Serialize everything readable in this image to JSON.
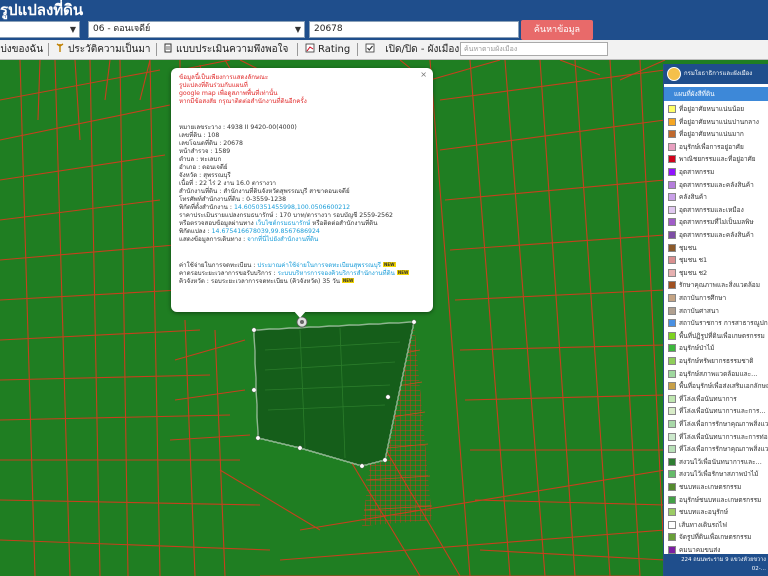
{
  "header": {
    "title": "รูปแปลงที่ดิน",
    "district_select": "06 - ดอนเจดีย์",
    "parcel_input": "20678",
    "search_button": "ค้นหาข้อมูล"
  },
  "toolbar": {
    "items": [
      {
        "label": "แบ่งของฉัน",
        "icon": "location-icon"
      },
      {
        "label": "ประวัติความเป็นมา",
        "icon": "history-icon"
      },
      {
        "label": "แบบประเมินความพึงพอใจ",
        "icon": "document-icon"
      },
      {
        "label": "Rating",
        "icon": "chart-icon"
      },
      {
        "label": "เปิด/ปิด - ผังเมือง",
        "icon": "checkbox-icon"
      }
    ],
    "search_placeholder": "ค้นหาตามผังเมือง"
  },
  "popup": {
    "disclaimer": [
      "ข้อมูลนี้เป็นเพียงการแสดงลักษณะ",
      "รูปแปลงที่ดินร่วมกับแผนที่",
      "google map เพื่อดูสภาพพื้นที่เท่านั้น",
      "หากมีข้อสงสัย กรุณาติดต่อสำนักงานที่ดินอีกครั้ง"
    ],
    "fields": [
      {
        "label": "หมายเลขระวาง",
        "value": "4938 II 9420-00(4000)"
      },
      {
        "label": "เลขที่ดิน",
        "value": "108"
      },
      {
        "label": "เลขโฉนดที่ดิน",
        "value": "20678"
      },
      {
        "label": "หน้าสำรวจ",
        "value": "1589"
      },
      {
        "label": "ตำบล",
        "value": "ทะเลบก"
      },
      {
        "label": "อำเภอ",
        "value": "ดอนเจดีย์"
      },
      {
        "label": "จังหวัด",
        "value": "สุพรรณบุรี"
      },
      {
        "label": "เนื้อที่",
        "value": "22 ไร่ 2 งาน 16.0 ตารางวา"
      },
      {
        "label": "สำนักงานที่ดิน",
        "value": "สำนักงานที่ดินจังหวัดสุพรรณบุรี สาขาดอนเจดีย์"
      },
      {
        "label": "โทรศัพท์สำนักงานที่ดิน",
        "value": "0-3559-1238"
      }
    ],
    "office_coords_label": "พิกัดที่ตั้งสำนักงาน",
    "office_coords": "14.6050351455998,100.0506600212",
    "price_text": "ราคาประเมินรายแปลงกรมธนารักษ์ : 170 บาท/ตารางวา รอบบัญชี 2559-2562",
    "check_text_prefix": "หรือตรวจสอบข้อมูลผ่านทาง",
    "check_link": "เว็บไซต์กรมธนารักษ์",
    "check_text_suffix": "หรือติดต่อสำนักงานที่ดิน",
    "parcel_coords_label": "พิกัดแปลง",
    "parcel_coords": "14.675416678039,99.8567686924",
    "route_label": "แสดงข้อมูลการเดินทาง",
    "route_link": "จากที่นี่ไปยังสำนักงานที่ดิน",
    "services": [
      {
        "label": "ค่าใช้จ่ายในการจดทะเบียน",
        "link": "ประมาณค่าใช้จ่ายในการจดทะเบียนสุพรรณบุรี",
        "badge": "NEW"
      },
      {
        "label": "คาดรอบระยะเวลาการขอรับบริการ",
        "link": "ระบบบริหารการจองคิวบริการสำนักงานที่ดิน",
        "badge": "NEW"
      },
      {
        "label": "คิวจังหวัด",
        "link": "รอบระยะเวลาการจดทะเบียน (คิวจังหวัด) 35 วัน",
        "badge": "NEW"
      }
    ],
    "close": "×"
  },
  "legend": {
    "agency": "กรมโยธาธิการและผังเมือง",
    "subtitle": "แผนที่ผังสีที่ดิน",
    "items": [
      {
        "color": "#ffff66",
        "label": "ที่อยู่อาศัยหนาแน่นน้อย"
      },
      {
        "color": "#f5a623",
        "label": "ที่อยู่อาศัยหนาแน่นปานกลาง"
      },
      {
        "color": "#c0692e",
        "label": "ที่อยู่อาศัยหนาแน่นมาก"
      },
      {
        "color": "#e8a0c0",
        "label": "อนุรักษ์เพื่อการอยู่อาศัย"
      },
      {
        "color": "#d0021b",
        "label": "พาณิชยกรรมและที่อยู่อาศัย"
      },
      {
        "color": "#9013fe",
        "label": "อุตสาหกรรม"
      },
      {
        "color": "#b57edc",
        "label": "อุตสาหกรรมและคลังสินค้า"
      },
      {
        "color": "#c9a0e8",
        "label": "คลังสินค้า"
      },
      {
        "color": "#e0c8f0",
        "label": "อุตสาหกรรมและเหมือง"
      },
      {
        "color": "#a05cc8",
        "label": "อุตสาหกรรมที่ไม่เป็นมลพิษ"
      },
      {
        "color": "#7d4ea5",
        "label": "อุตสาหกรรมและคลังสินค้า"
      },
      {
        "color": "#8b5a2b",
        "label": "ชุมชน"
      },
      {
        "color": "#d98f8f",
        "label": "ชุมชน ช1"
      },
      {
        "color": "#e6b0b0",
        "label": "ชุมชน ช2"
      },
      {
        "color": "#a05020",
        "label": "รักษาคุณภาพและสิ่งแวดล้อม"
      },
      {
        "color": "#c4a484",
        "label": "สถาบันการศึกษา"
      },
      {
        "color": "#b0a090",
        "label": "สถาบันศาสนา"
      },
      {
        "color": "#4a90e2",
        "label": "สถาบันราชการ การสาธารณูปการและสาธารณูปโภค"
      },
      {
        "color": "#7ed321",
        "label": "พื้นที่ปฏิรูปที่ดินเพื่อเกษตรกรรม"
      },
      {
        "color": "#3db83d",
        "label": "อนุรักษ์ป่าไม้"
      },
      {
        "color": "#8fce5a",
        "label": "อนุรักษ์ทรัพยากรธรรมชาติ"
      },
      {
        "color": "#9fd89f",
        "label": "อนุรักษ์สภาพแวดล้อมและ..."
      },
      {
        "color": "#c8a048",
        "label": "พื้นที่อนุรักษ์เพื่อส่งเสริมเอกลักษณ์"
      },
      {
        "color": "#bfe6b0",
        "label": "ที่โล่งเพื่อนันทนาการ"
      },
      {
        "color": "#d8ecc8",
        "label": "ที่โล่งเพื่อนันทนาการและการ..."
      },
      {
        "color": "#a8d8a8",
        "label": "ที่โล่งเพื่อการรักษาคุณภาพสิ่งแวดล้อม"
      },
      {
        "color": "#cce8cc",
        "label": "ที่โล่งเพื่อนันทนาการและการท่องเที่ยว"
      },
      {
        "color": "#b8e0b8",
        "label": "ที่โล่งเพื่อการรักษาคุณภาพสิ่งแวดล้อม"
      },
      {
        "color": "#2e7d32",
        "label": "สงวนไว้เพื่อนันทนาการและ..."
      },
      {
        "color": "#66bb6a",
        "label": "สงวนไว้เพื่อรักษาสภาพป่าไม้"
      },
      {
        "color": "#558b2f",
        "label": "ชนบทและเกษตรกรรม"
      },
      {
        "color": "#43a047",
        "label": "อนุรักษ์ชนบทและเกษตรกรรม"
      },
      {
        "color": "#9ccc65",
        "label": "ชนบทและอนุรักษ์"
      },
      {
        "color": "#ffffff",
        "label": "เส้นทางเดินรถไฟ"
      },
      {
        "color": "#689f38",
        "label": "จัดรูปที่ดินเพื่อเกษตรกรรม"
      },
      {
        "color": "#7b1fa2",
        "label": "คมนาคมขนส่ง"
      }
    ],
    "footer_line1": "224 ถนนพระราม 9 แขวงห้วยขวาง",
    "footer_line2": "02-..."
  }
}
